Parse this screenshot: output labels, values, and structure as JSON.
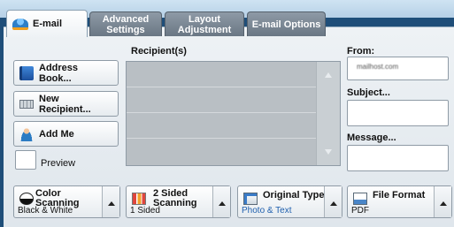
{
  "tabs": [
    {
      "label": "E-mail",
      "active": true
    },
    {
      "label": "Advanced\nSettings",
      "active": false
    },
    {
      "label": "Layout\nAdjustment",
      "active": false
    },
    {
      "label": "E-mail Options",
      "active": false
    }
  ],
  "recipients": {
    "header": "Recipient(s)",
    "rows": [
      "",
      "",
      "",
      ""
    ]
  },
  "left_buttons": {
    "address_book": "Address\nBook...",
    "new_recipient": "New\nRecipient...",
    "add_me": "Add Me",
    "preview": "Preview"
  },
  "right_fields": {
    "from_label": "From:",
    "from_value": "mailhost.com",
    "subject_label": "Subject...",
    "message_label": "Message..."
  },
  "bottom_buttons": [
    {
      "title": "Color\nScanning",
      "value": "Black & White",
      "icon": "color-scanning-icon",
      "value_color": "#111111"
    },
    {
      "title": "2 Sided\nScanning",
      "value": "1 Sided",
      "icon": "two-sided-icon",
      "value_color": "#111111"
    },
    {
      "title": "Original Type",
      "value": "Photo & Text",
      "icon": "original-type-icon",
      "value_color": "#1f5fae"
    },
    {
      "title": "File Format",
      "value": "PDF",
      "icon": "file-format-icon",
      "value_color": "#111111"
    }
  ]
}
